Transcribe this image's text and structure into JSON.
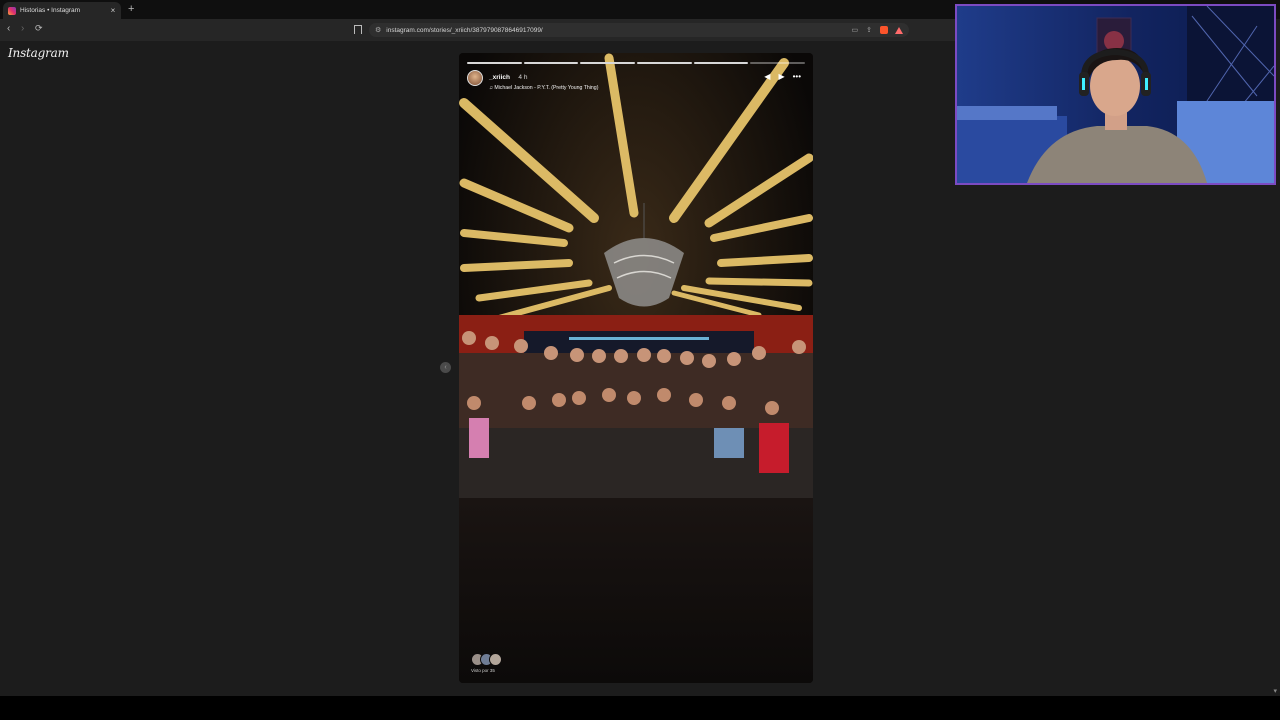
{
  "browser": {
    "tab_title": "Historias • Instagram",
    "new_tab_glyph": "+",
    "close_glyph": "×",
    "url": "instagram.com/stories/_xriich/3879790878646917099/",
    "nav": {
      "back_glyph": "‹",
      "forward_glyph": "›",
      "reload_glyph": "⟳"
    }
  },
  "page": {
    "logo_text": "Instagram",
    "prev_glyph": "‹"
  },
  "story": {
    "username": "_xriich",
    "time": "4 h",
    "music": "♫  Michael Jackson - P.Y.T. (Pretty Young Thing)",
    "controls": {
      "mute_glyph": "◀",
      "play_glyph": "▶",
      "more_glyph": "•••"
    },
    "segments": [
      1,
      1,
      1,
      1,
      1,
      0
    ],
    "views_text": "Visto por 35"
  },
  "icons": {
    "tab_favicon": "instagram-icon",
    "address_lock": "site-settings-icon",
    "bookmark": "bookmark-icon",
    "brave_shield": "brave-shield-icon",
    "rewards": "brave-rewards-icon",
    "cast": "cast-icon",
    "share": "share-icon"
  },
  "colors": {
    "page_bg": "#1c1c1c",
    "webcam_border": "#7c4bc2",
    "brave_orange": "#fb542b"
  }
}
